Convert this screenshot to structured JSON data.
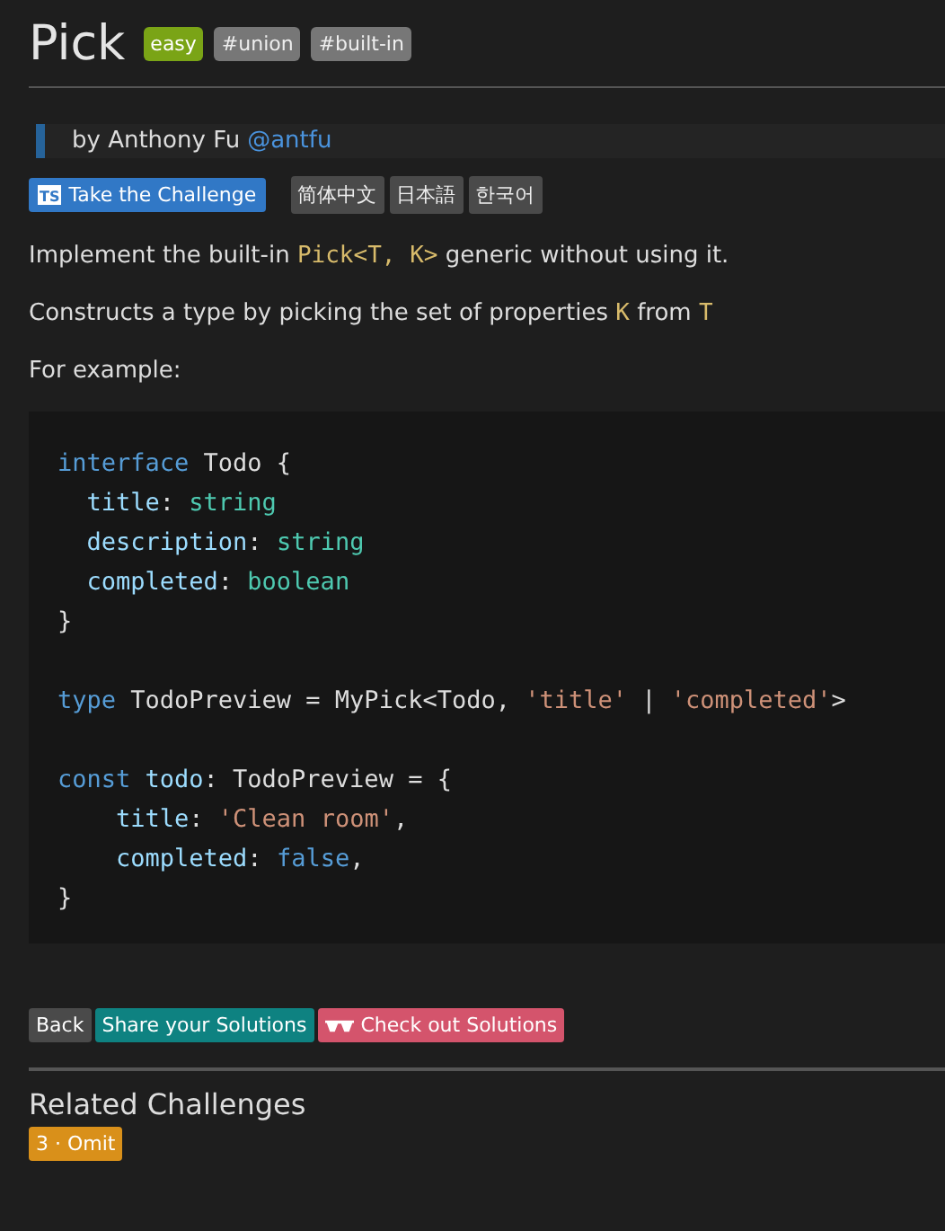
{
  "title": "Pick",
  "difficulty": {
    "label": "easy",
    "kind": "easy"
  },
  "tags": [
    "#union",
    "#built-in"
  ],
  "author": {
    "prefix": "by Anthony Fu",
    "handle": "@antfu"
  },
  "challenge_button": {
    "icon": "TS",
    "label": "Take the Challenge"
  },
  "languages": [
    "简体中文",
    "日本語",
    "한국어"
  ],
  "paragraphs": [
    [
      {
        "text": "Implement the built-in ",
        "kind": "prose"
      },
      {
        "text": "Pick<T, K>",
        "kind": "code"
      },
      {
        "text": " generic without using it.",
        "kind": "prose"
      }
    ],
    [
      {
        "text": "Constructs a type by picking the set of properties ",
        "kind": "prose"
      },
      {
        "text": "K",
        "kind": "code"
      },
      {
        "text": " from ",
        "kind": "prose"
      },
      {
        "text": "T",
        "kind": "code"
      }
    ],
    [
      {
        "text": "For example:",
        "kind": "prose"
      }
    ]
  ],
  "code_lines": [
    {
      "kind": "code",
      "tokens": [
        {
          "text": "interface",
          "kind": "keyword"
        },
        {
          "text": " Todo {",
          "kind": "plain"
        }
      ]
    },
    {
      "kind": "code",
      "tokens": [
        {
          "text": "  title",
          "kind": "property"
        },
        {
          "text": ": ",
          "kind": "plain"
        },
        {
          "text": "string",
          "kind": "type"
        }
      ]
    },
    {
      "kind": "code",
      "tokens": [
        {
          "text": "  description",
          "kind": "property"
        },
        {
          "text": ": ",
          "kind": "plain"
        },
        {
          "text": "string",
          "kind": "type"
        }
      ]
    },
    {
      "kind": "code",
      "tokens": [
        {
          "text": "  completed",
          "kind": "property"
        },
        {
          "text": ": ",
          "kind": "plain"
        },
        {
          "text": "boolean",
          "kind": "type"
        }
      ]
    },
    {
      "kind": "code",
      "tokens": [
        {
          "text": "}",
          "kind": "plain"
        }
      ]
    },
    {
      "kind": "blank"
    },
    {
      "kind": "code",
      "tokens": [
        {
          "text": "type",
          "kind": "keyword"
        },
        {
          "text": " TodoPreview = MyPick<Todo, ",
          "kind": "plain"
        },
        {
          "text": "'title'",
          "kind": "string"
        },
        {
          "text": " | ",
          "kind": "plain"
        },
        {
          "text": "'completed'",
          "kind": "string"
        },
        {
          "text": ">",
          "kind": "plain"
        }
      ]
    },
    {
      "kind": "blank"
    },
    {
      "kind": "code",
      "tokens": [
        {
          "text": "const",
          "kind": "keyword"
        },
        {
          "text": " todo",
          "kind": "property"
        },
        {
          "text": ": TodoPreview = {",
          "kind": "plain"
        }
      ]
    },
    {
      "kind": "code",
      "tokens": [
        {
          "text": "    title",
          "kind": "property"
        },
        {
          "text": ": ",
          "kind": "plain"
        },
        {
          "text": "'Clean room'",
          "kind": "string"
        },
        {
          "text": ",",
          "kind": "plain"
        }
      ]
    },
    {
      "kind": "code",
      "tokens": [
        {
          "text": "    completed",
          "kind": "property"
        },
        {
          "text": ": ",
          "kind": "plain"
        },
        {
          "text": "false",
          "kind": "keyword"
        },
        {
          "text": ",",
          "kind": "plain"
        }
      ]
    },
    {
      "kind": "code",
      "tokens": [
        {
          "text": "}",
          "kind": "plain"
        }
      ]
    }
  ],
  "actions": [
    {
      "label": "Back",
      "kind": "back"
    },
    {
      "label": "Share your Solutions",
      "kind": "share"
    },
    {
      "label": "Check out Solutions",
      "kind": "solutions"
    }
  ],
  "related": {
    "heading": "Related Challenges",
    "items": [
      {
        "label": "3 · Omit",
        "color": "#d9901a"
      }
    ]
  }
}
